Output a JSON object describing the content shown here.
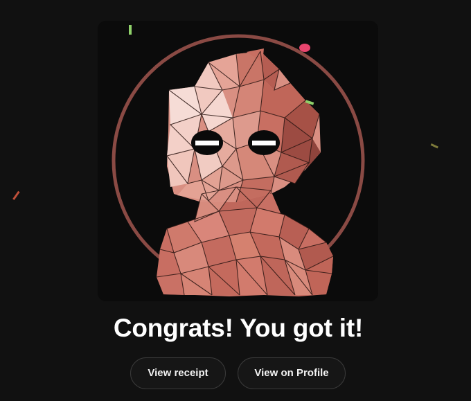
{
  "nft": {
    "image_name": "low-poly-figure-with-visor-eyes",
    "ring_color": "#8a4a44",
    "primary_color": "#d27a6c",
    "highlight_color": "#f6dcd6",
    "shadow_color": "#9c4b42"
  },
  "confetti": [
    {
      "color": "#8fd16a",
      "kind": "stick"
    },
    {
      "color": "#e8456e",
      "kind": "dot"
    },
    {
      "color": "#8fd16a",
      "kind": "stick"
    },
    {
      "color": "#c0503a",
      "kind": "stick"
    },
    {
      "color": "#7d7a3a",
      "kind": "stick"
    }
  ],
  "headline": "Congrats! You got it!",
  "actions": {
    "view_receipt": "View receipt",
    "view_on_profile": "View on Profile"
  }
}
